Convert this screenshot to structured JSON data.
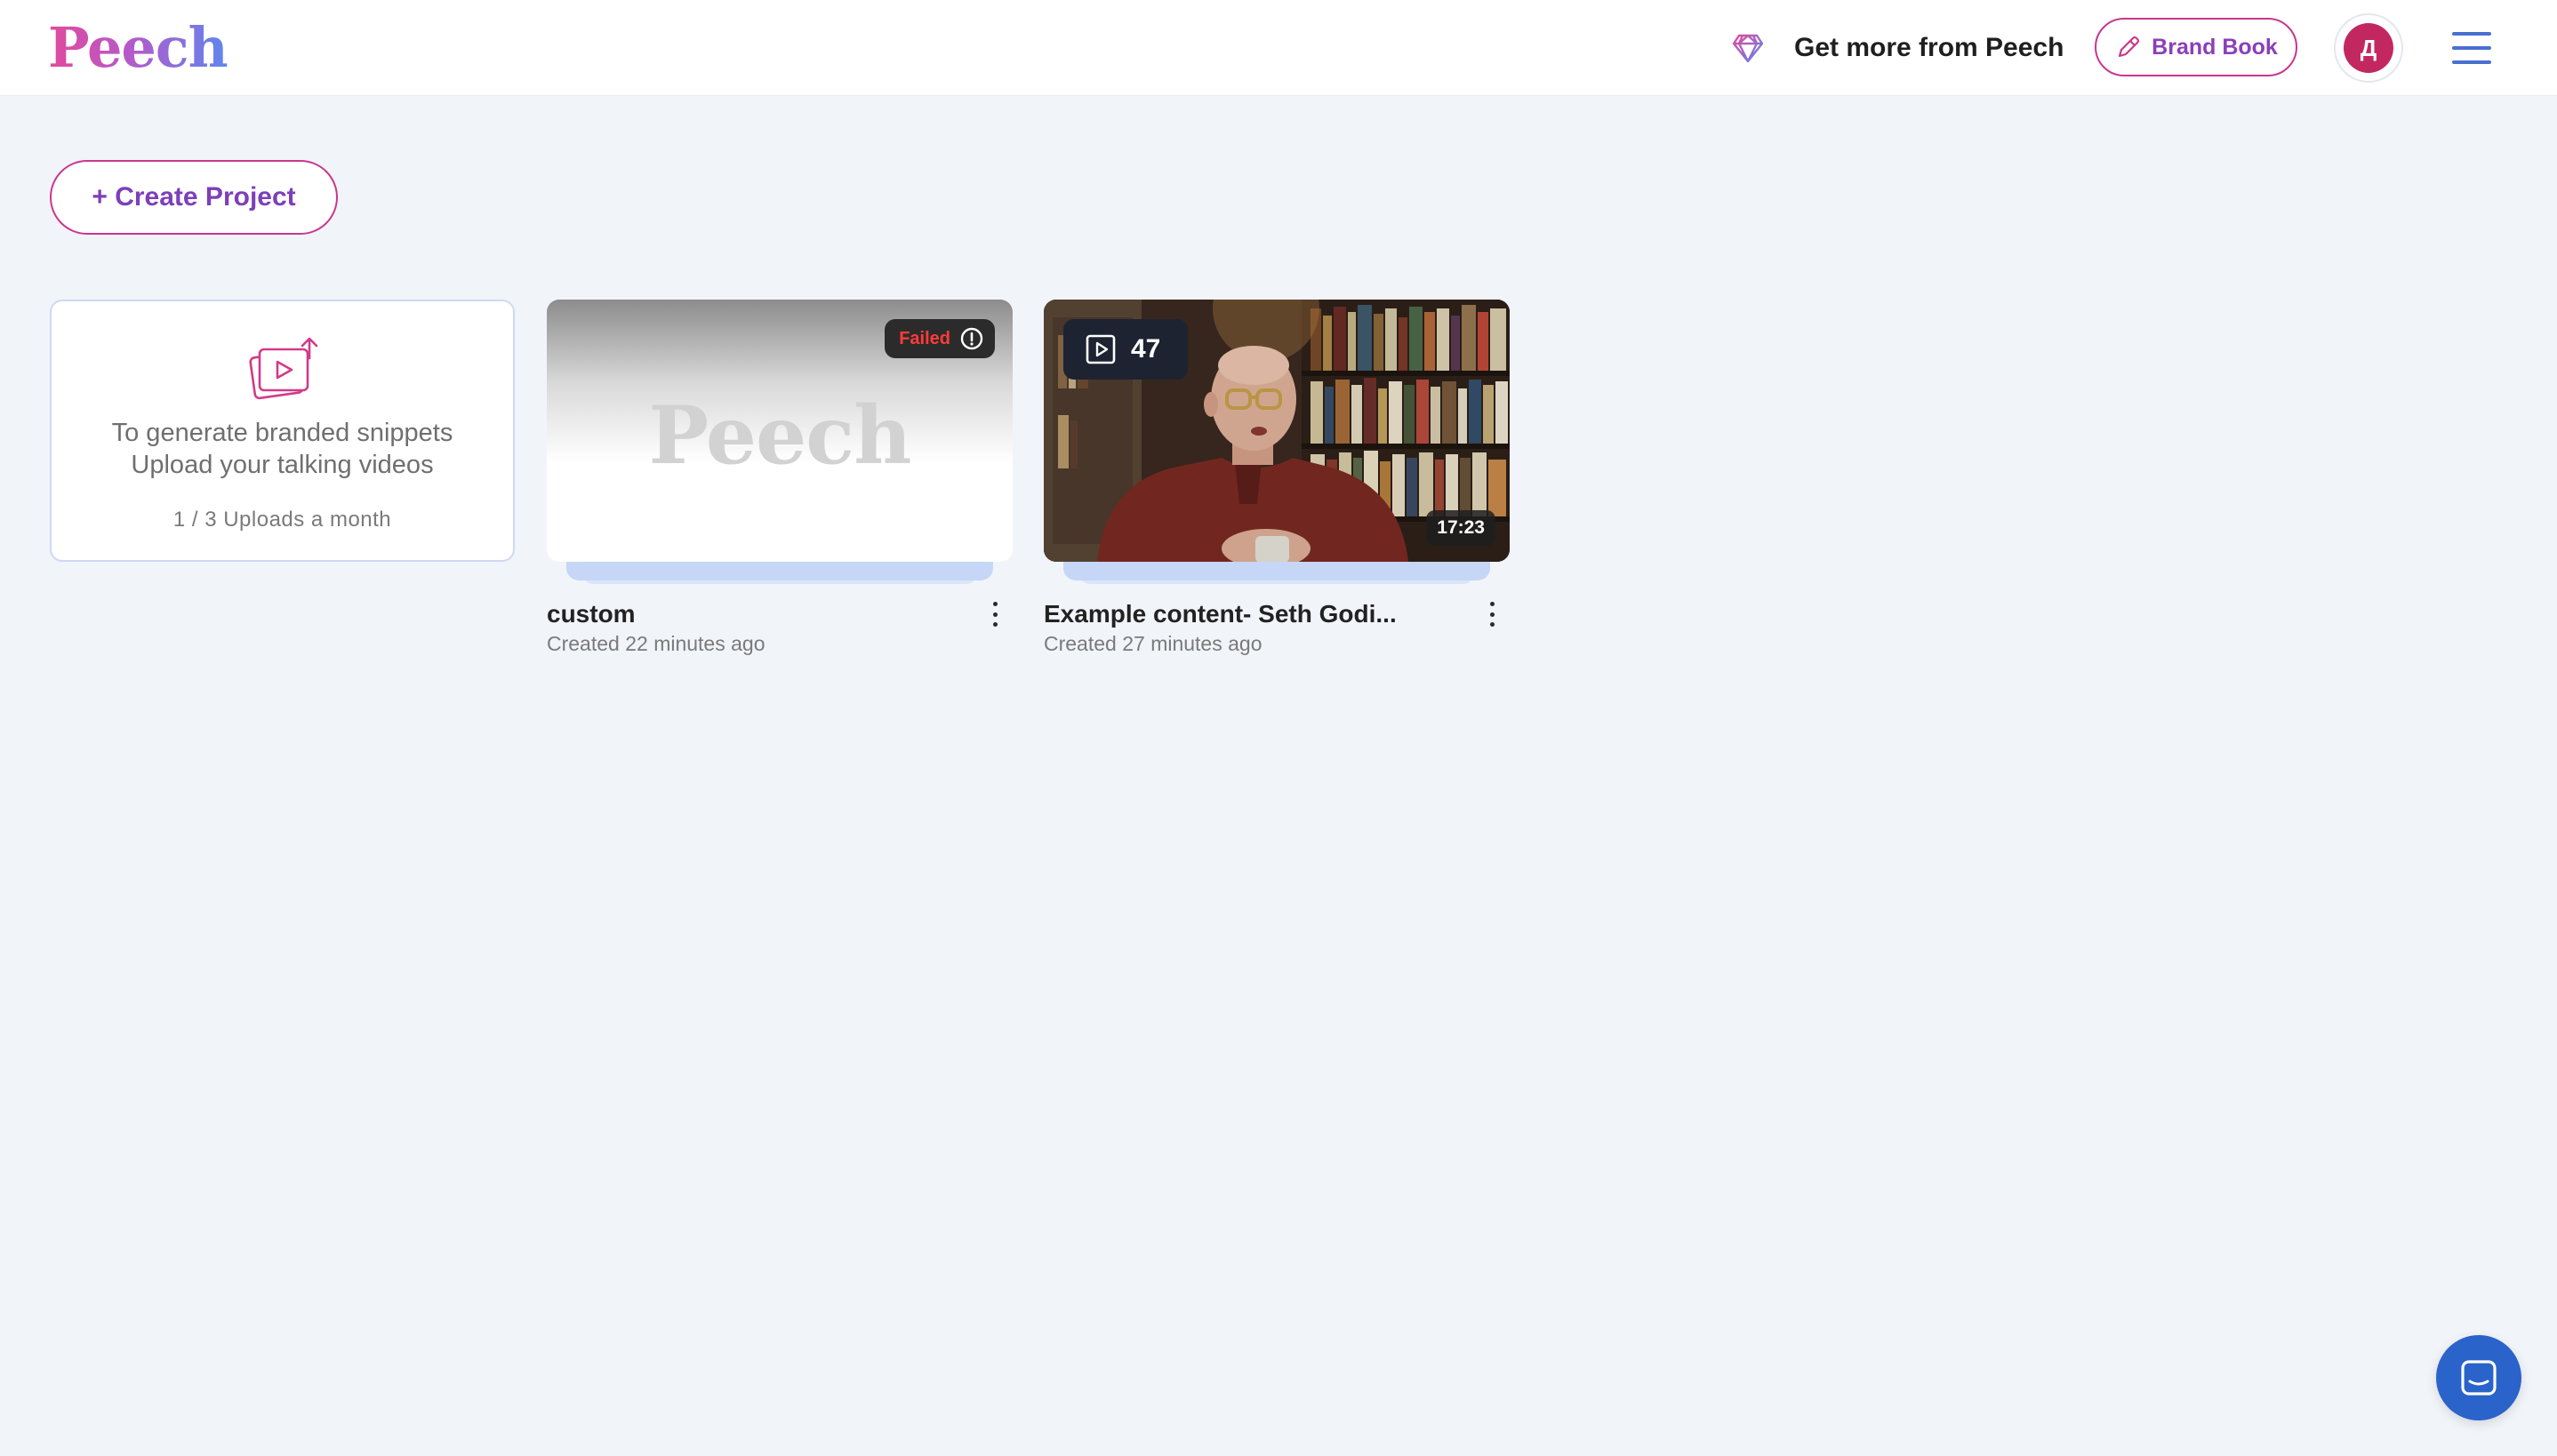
{
  "header": {
    "logo": "Peech",
    "upsell_icon": "diamond-icon",
    "upsell_text": "Get more from Peech",
    "brand_book_label": "Brand Book",
    "brand_book_icon": "pen-icon",
    "avatar_initial": "Д",
    "menu_icon": "hamburger-menu-icon"
  },
  "toolbar": {
    "create_project_label": "+ Create Project"
  },
  "upload_card": {
    "icon": "upload-videos-icon",
    "line1": "To generate branded snippets",
    "line2": "Upload your talking videos",
    "quota": "1 / 3 Uploads a month"
  },
  "projects": [
    {
      "title": "custom",
      "created": "Created 22 minutes ago",
      "status": "Failed",
      "thumbnail_watermark": "Peech"
    },
    {
      "title": "Example content- Seth Godi...",
      "created": "Created 27 minutes ago",
      "clips_count": "47",
      "duration": "17:23"
    }
  ],
  "chat": {
    "icon": "chat-icon"
  },
  "colors": {
    "background": "#f1f4f9",
    "accent_pink": "#c9378f",
    "accent_purple": "#7d3fb9",
    "accent_blue": "#4a6fd1",
    "failed_red": "#ff3b3b",
    "avatar": "#c2285f",
    "chat_button": "#2a63c9"
  }
}
